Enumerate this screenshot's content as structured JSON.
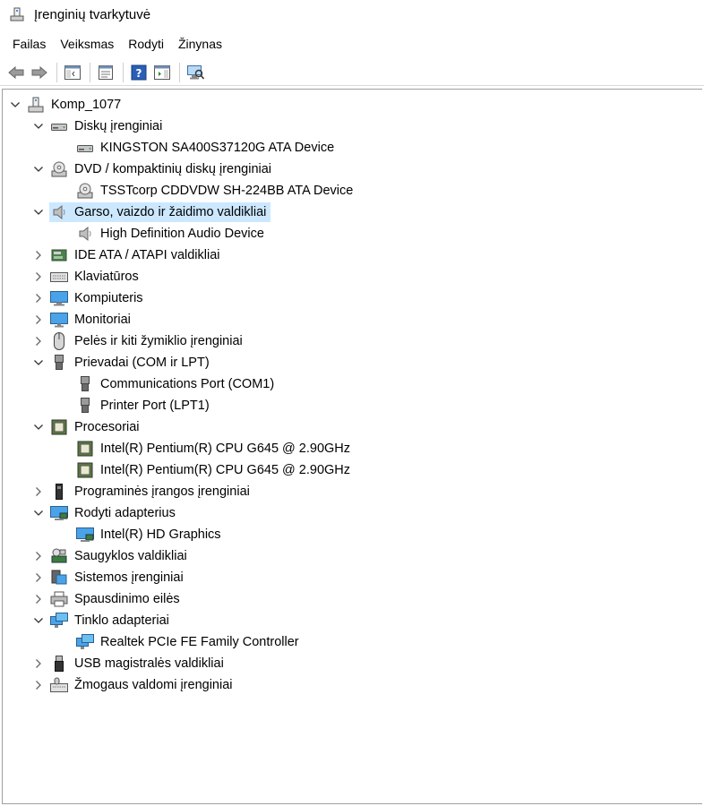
{
  "window": {
    "title": "Įrenginių tvarkytuvė"
  },
  "menu": [
    "Failas",
    "Veiksmas",
    "Rodyti",
    "Žinynas"
  ],
  "toolbar": [
    "back-arrow-icon",
    "forward-arrow-icon",
    "show-hide-console-tree-icon",
    "properties-icon",
    "help-icon",
    "action-pane-icon",
    "scan-hardware-icon"
  ],
  "tree": {
    "root": "Komp_1077",
    "categories": [
      {
        "label": "Diskų įrenginiai",
        "icon": "disk-drive-icon",
        "expanded": true,
        "children": [
          "KINGSTON SA400S37120G ATA Device"
        ]
      },
      {
        "label": "DVD / kompaktinių diskų įrenginiai",
        "icon": "dvd-drive-icon",
        "expanded": true,
        "children": [
          "TSSTcorp CDDVDW SH-224BB ATA Device"
        ]
      },
      {
        "label": "Garso, vaizdo ir žaidimo valdikliai",
        "icon": "speaker-icon",
        "expanded": true,
        "selected": true,
        "children": [
          "High Definition Audio Device"
        ]
      },
      {
        "label": "IDE ATA / ATAPI valdikliai",
        "icon": "ide-controller-icon",
        "expanded": false,
        "children": []
      },
      {
        "label": "Klaviatūros",
        "icon": "keyboard-icon",
        "expanded": false,
        "children": []
      },
      {
        "label": "Kompiuteris",
        "icon": "computer-icon",
        "expanded": false,
        "children": []
      },
      {
        "label": "Monitoriai",
        "icon": "monitor-icon",
        "expanded": false,
        "children": []
      },
      {
        "label": "Pelės ir kiti žymiklio įrenginiai",
        "icon": "mouse-icon",
        "expanded": false,
        "children": []
      },
      {
        "label": "Prievadai (COM ir LPT)",
        "icon": "port-icon",
        "expanded": true,
        "children": [
          "Communications Port (COM1)",
          "Printer Port (LPT1)"
        ]
      },
      {
        "label": "Procesoriai",
        "icon": "processor-icon",
        "expanded": true,
        "children": [
          "Intel(R) Pentium(R) CPU G645 @ 2.90GHz",
          "Intel(R) Pentium(R) CPU G645 @ 2.90GHz"
        ]
      },
      {
        "label": "Programinės įrangos įrenginiai",
        "icon": "software-device-icon",
        "expanded": false,
        "children": []
      },
      {
        "label": "Rodyti adapterius",
        "icon": "display-adapter-icon",
        "expanded": true,
        "children": [
          "Intel(R) HD Graphics"
        ]
      },
      {
        "label": "Saugyklos valdikliai",
        "icon": "storage-controller-icon",
        "expanded": false,
        "children": []
      },
      {
        "label": "Sistemos įrenginiai",
        "icon": "system-device-icon",
        "expanded": false,
        "children": []
      },
      {
        "label": "Spausdinimo eilės",
        "icon": "printer-icon",
        "expanded": false,
        "children": []
      },
      {
        "label": "Tinklo adapteriai",
        "icon": "network-adapter-icon",
        "expanded": true,
        "children": [
          "Realtek PCIe FE Family Controller"
        ]
      },
      {
        "label": "USB magistralės valdikliai",
        "icon": "usb-icon",
        "expanded": false,
        "children": []
      },
      {
        "label": "Žmogaus valdomi įrenginiai",
        "icon": "hid-icon",
        "expanded": false,
        "children": []
      }
    ]
  }
}
